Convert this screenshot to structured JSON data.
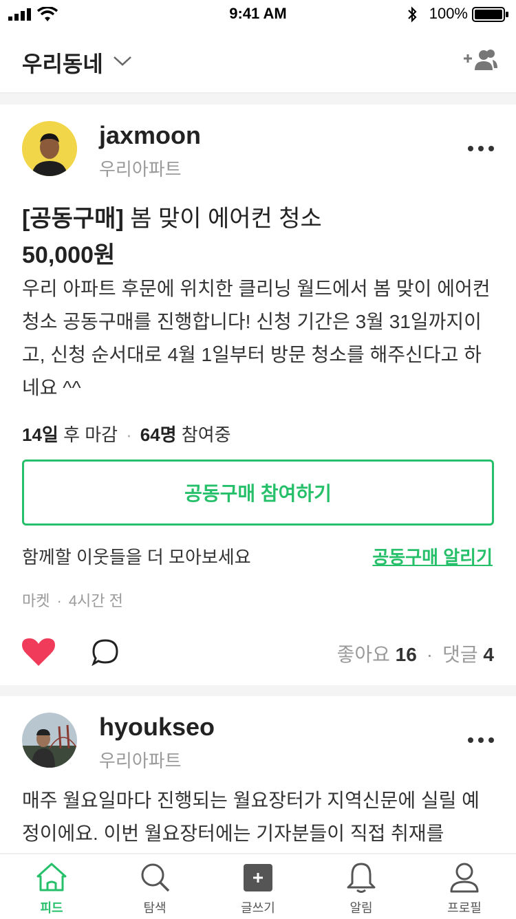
{
  "status": {
    "time": "9:41 AM",
    "battery": "100%"
  },
  "header": {
    "title": "우리동네"
  },
  "posts": [
    {
      "username": "jaxmoon",
      "location": "우리아파트",
      "title_tag": "[공동구매]",
      "title_rest": " 봄 맞이 에어컨 청소",
      "price": "50,000원",
      "body": "우리 아파트 후문에 위치한 클리닝 월드에서 봄 맞이 에어컨 청소 공동구매를 진행합니다! 신청 기간은 3월 31일까지이고, 신청 순서대로 4월 1일부터 방문 청소를 해주신다고 하네요 ^^",
      "deadline_num": "14일",
      "deadline_text": " 후 마감",
      "participants_num": "64명",
      "participants_text": " 참여중",
      "join_button": "공동구매 참여하기",
      "invite_text": "함께할 이웃들을 더 모아보세요",
      "notify_link": "공동구매 알리기",
      "category": "마켓",
      "time_ago": "4시간 전",
      "likes_label": "좋아요",
      "likes_count": "16",
      "comments_label": "댓글",
      "comments_count": "4"
    },
    {
      "username": "hyoukseo",
      "location": "우리아파트",
      "body": "매주 월요일마다 진행되는 월요장터가 지역신문에 실릴 예정이에요. 이번 월요장터에는 기자분들이 직접 취재를"
    }
  ],
  "tabs": [
    {
      "label": "피드",
      "icon": "home-icon",
      "active": true
    },
    {
      "label": "탐색",
      "icon": "search-icon"
    },
    {
      "label": "글쓰기",
      "icon": "write-icon"
    },
    {
      "label": "알림",
      "icon": "bell-icon"
    },
    {
      "label": "프로필",
      "icon": "profile-icon"
    }
  ],
  "colors": {
    "accent": "#26c06a",
    "heart": "#f03c5a",
    "muted": "#9a9a9a"
  }
}
